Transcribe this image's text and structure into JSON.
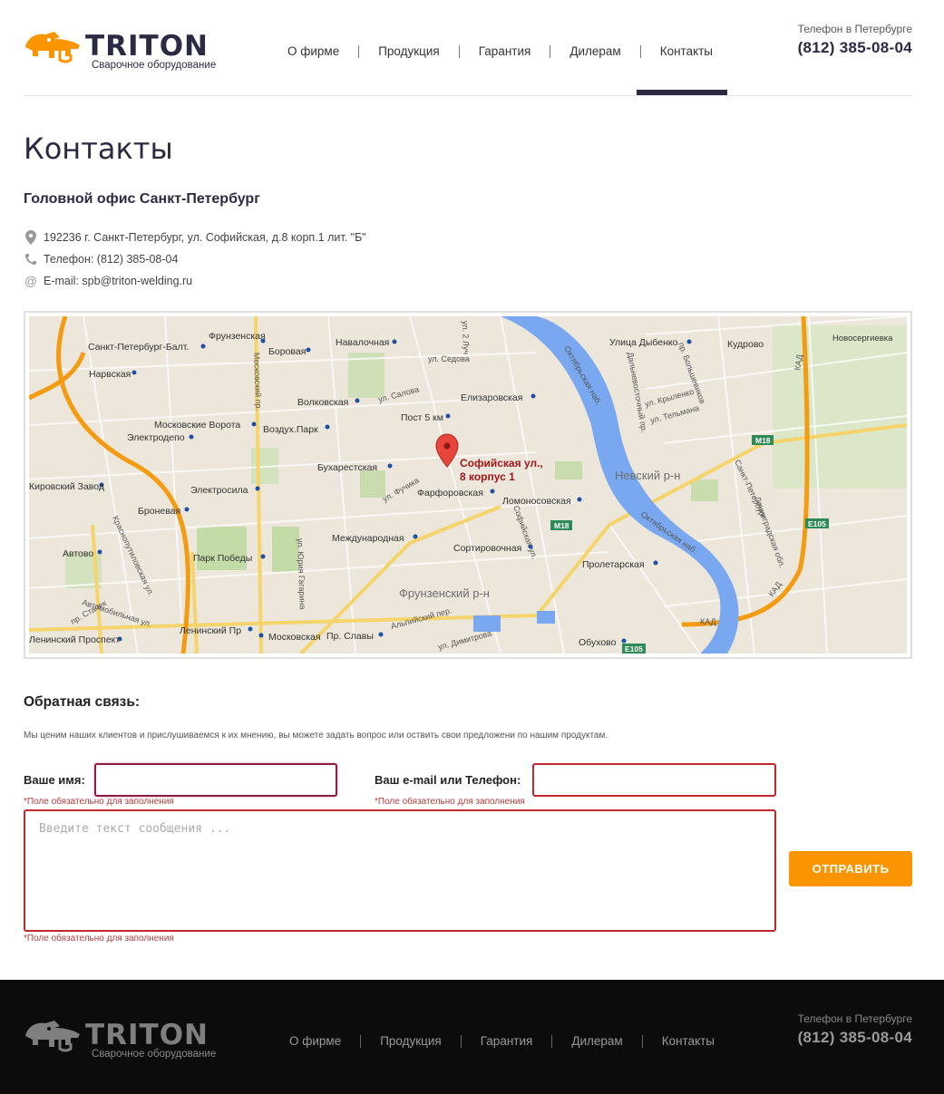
{
  "brand": {
    "name": "TRITON",
    "tagline": "Сварочное оборудование",
    "accent": "#fa9500",
    "dark": "#2b2a45"
  },
  "nav": [
    {
      "label": "О фирме"
    },
    {
      "label": "Продукция"
    },
    {
      "label": "Гарантия"
    },
    {
      "label": "Дилерам"
    },
    {
      "label": "Контакты",
      "active": true
    }
  ],
  "header_phone": {
    "label": "Телефон в Петербурге",
    "number": "(812) 385-08-04"
  },
  "page": {
    "title": "Контакты",
    "office_title": "Головной офис Санкт-Петербург",
    "address": "192236 г. Санкт-Петербург, ул. Софийская, д.8 корп.1 лит. \"Б\"",
    "phone": "Телефон: (812) 385-08-04",
    "email": "E-mail: spb@triton-welding.ru"
  },
  "map": {
    "marker_label_1": "Софийская ул.,",
    "marker_label_2": "8 корпус 1",
    "labels": {
      "l1": "Санкт-Петербург-Балт.",
      "l2": "Фрунзенская",
      "l3": "Боровая",
      "l4": "Навалочная",
      "l5": "ул. 2 Луч",
      "l6": "Улица Дыбенко",
      "l7": "Кудрово",
      "l8": "Новосергиевка",
      "l9": "Нарвская",
      "l10": "ул. Седова",
      "l11": "Волковская",
      "l12": "ул. Салова",
      "l13": "Елизаровская",
      "l14": "Московские Ворота",
      "l15": "Воздух.Парк",
      "l16": "Пост 5 км",
      "l17": "Электродепо",
      "l18": "Бухарестская",
      "l19": "Невский р-н",
      "l20": "Ломоносовская",
      "l21": "Фарфоровская",
      "l22": "Электросила",
      "l23": "Броневая",
      "l24": "Кировский Завод",
      "l25": "ул. Фучика",
      "l26": "Международная",
      "l27": "Сортировочная",
      "l28": "Парк Победы",
      "l29": "Автово",
      "l30": "Пролетарская",
      "l31": "Фрунзенский р-н",
      "l32": "Ленинский Пр",
      "l33": "Московская",
      "l34": "Пр. Славы",
      "l35": "ул. Димитрова",
      "l36": "Ленинский Проспект",
      "l37": "Обухово",
      "l38": "Московский пр.",
      "l39": "ул. Юрия Гагарина",
      "l40": "Октябрьская наб.",
      "l41": "Дальневосточный пр.",
      "l42": "пр. Большевиков",
      "l43": "ул. Крыленко",
      "l44": "ул. Тельмана",
      "l45": "Ленинградская обл.",
      "l46": "Санкт-Петербург",
      "l47": "КАД",
      "l48": "М18",
      "l49": "Е105",
      "l50": "Краснопутиловская ул.",
      "l51": "Автомобильная ул.",
      "l52": "пр. Стачек",
      "l53": "Альпийский пер.",
      "l54": "Софийская ул."
    }
  },
  "feedback": {
    "title": "Обратная связь:",
    "description": "Мы ценим наших клиентов и прислушиваемся к их мнению, вы можете задать вопрос или оствить свои предложени по нашим продуктам.",
    "name_label": "Ваше имя:",
    "name_value": "",
    "contact_label": "Ваш e-mail или Телефон:",
    "contact_value": "",
    "message_placeholder": "Введите текст сообщения ...",
    "required_text": "*Поле обязательно для заполнения",
    "submit_label": "ОТПРАВИТЬ"
  },
  "footer": {
    "phone_label": "Телефон в Петербурге",
    "phone_number": "(812) 385-08-04"
  },
  "icons": [
    "logo-icon",
    "location-pin-icon",
    "phone-icon",
    "at-icon",
    "map-marker-icon",
    "metro-icon"
  ]
}
